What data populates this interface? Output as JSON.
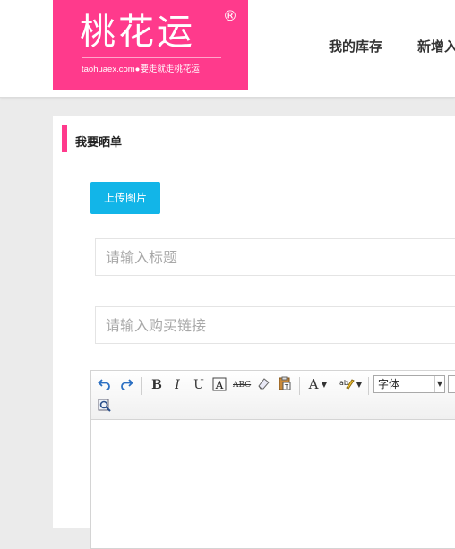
{
  "header": {
    "logo": {
      "brand": "桃花运",
      "registered": "®",
      "tagline": "taohuaex.com●要走就走桃花运"
    },
    "nav": [
      "我的库存",
      "新增入"
    ]
  },
  "card": {
    "title": "我要晒单",
    "upload_button": "上传图片",
    "title_field": {
      "placeholder": "请输入标题",
      "value": ""
    },
    "link_field": {
      "placeholder": "请输入购买链接",
      "value": ""
    }
  },
  "editor": {
    "toolbar": {
      "font_select": {
        "value": "字体"
      },
      "text_color_glyph": "A"
    }
  },
  "colors": {
    "brand_pink": "#ff3a8c",
    "button_blue": "#12b5e8",
    "background": "#ebebeb"
  }
}
